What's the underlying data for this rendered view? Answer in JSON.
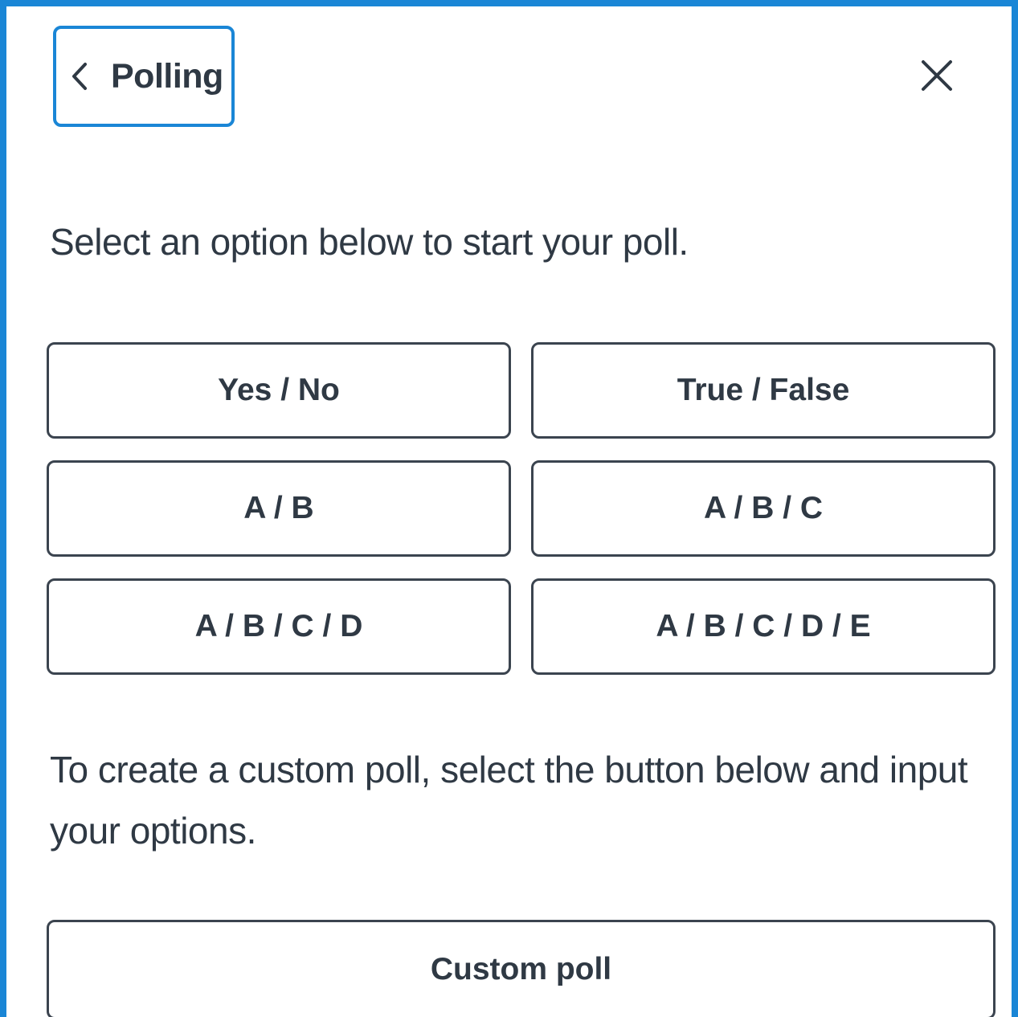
{
  "header": {
    "back_label": "Polling",
    "back_icon": "chevron-left-icon",
    "close_icon": "close-icon"
  },
  "intro_text": "Select an option below to start your poll.",
  "options": [
    "Yes / No",
    "True / False",
    "A / B",
    "A / B / C",
    "A / B / C / D",
    "A / B / C / D / E"
  ],
  "custom": {
    "description": "To create a custom poll, select the button below and input your options.",
    "button_label": "Custom poll"
  },
  "colors": {
    "accent": "#1a86d6",
    "text": "#2f3944",
    "border": "#3b444f"
  }
}
